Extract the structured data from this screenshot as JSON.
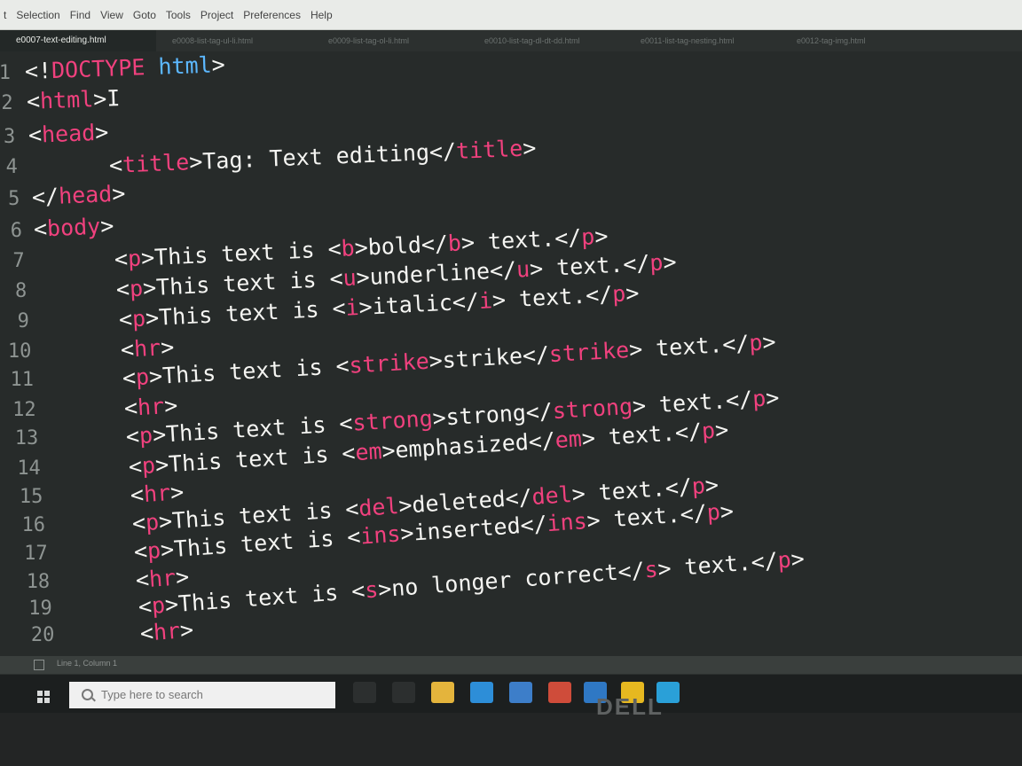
{
  "menu": [
    "t",
    "Selection",
    "Find",
    "View",
    "Goto",
    "Tools",
    "Project",
    "Preferences",
    "Help"
  ],
  "tabs": [
    {
      "label": "e0007-text-editing.html",
      "active": true
    },
    {
      "label": "e0008-list-tag-ul-li.html",
      "active": false
    },
    {
      "label": "e0009-list-tag-ol-li.html",
      "active": false
    },
    {
      "label": "e0010-list-tag-dl-dt-dd.html",
      "active": false
    },
    {
      "label": "e0011-list-tag-nesting.html",
      "active": false
    },
    {
      "label": "e0012-tag-img.html",
      "active": false
    }
  ],
  "lines": [
    {
      "num": "1",
      "indent": 0,
      "tokens": [
        {
          "t": "p",
          "v": "<!"
        },
        {
          "t": "t",
          "v": "DOCTYPE"
        },
        {
          "t": "p",
          "v": " "
        },
        {
          "t": "a",
          "v": "html"
        },
        {
          "t": "p",
          "v": ">"
        }
      ]
    },
    {
      "num": "2",
      "indent": 0,
      "tokens": [
        {
          "t": "p",
          "v": "<"
        },
        {
          "t": "t",
          "v": "html"
        },
        {
          "t": "p",
          "v": ">"
        },
        {
          "t": "p",
          "v": "I"
        }
      ]
    },
    {
      "num": "3",
      "indent": 0,
      "tokens": [
        {
          "t": "p",
          "v": "<"
        },
        {
          "t": "t",
          "v": "head"
        },
        {
          "t": "p",
          "v": ">"
        }
      ]
    },
    {
      "num": "4",
      "indent": 1,
      "tokens": [
        {
          "t": "p",
          "v": "<"
        },
        {
          "t": "t",
          "v": "title"
        },
        {
          "t": "p",
          "v": ">Tag: Text editing</"
        },
        {
          "t": "t",
          "v": "title"
        },
        {
          "t": "p",
          "v": ">"
        }
      ]
    },
    {
      "num": "5",
      "indent": 0,
      "tokens": [
        {
          "t": "p",
          "v": "</"
        },
        {
          "t": "t",
          "v": "head"
        },
        {
          "t": "p",
          "v": ">"
        }
      ]
    },
    {
      "num": "6",
      "indent": 0,
      "tokens": [
        {
          "t": "p",
          "v": "<"
        },
        {
          "t": "t",
          "v": "body"
        },
        {
          "t": "p",
          "v": ">"
        }
      ]
    },
    {
      "num": "7",
      "indent": 1,
      "tokens": [
        {
          "t": "p",
          "v": "<"
        },
        {
          "t": "t",
          "v": "p"
        },
        {
          "t": "p",
          "v": ">This text is <"
        },
        {
          "t": "t",
          "v": "b"
        },
        {
          "t": "p",
          "v": ">bold</"
        },
        {
          "t": "t",
          "v": "b"
        },
        {
          "t": "p",
          "v": "> text.</"
        },
        {
          "t": "t",
          "v": "p"
        },
        {
          "t": "p",
          "v": ">"
        }
      ]
    },
    {
      "num": "8",
      "indent": 1,
      "tokens": [
        {
          "t": "p",
          "v": "<"
        },
        {
          "t": "t",
          "v": "p"
        },
        {
          "t": "p",
          "v": ">This text is <"
        },
        {
          "t": "t",
          "v": "u"
        },
        {
          "t": "p",
          "v": ">underline</"
        },
        {
          "t": "t",
          "v": "u"
        },
        {
          "t": "p",
          "v": "> text.</"
        },
        {
          "t": "t",
          "v": "p"
        },
        {
          "t": "p",
          "v": ">"
        }
      ]
    },
    {
      "num": "9",
      "indent": 1,
      "tokens": [
        {
          "t": "p",
          "v": "<"
        },
        {
          "t": "t",
          "v": "p"
        },
        {
          "t": "p",
          "v": ">This text is <"
        },
        {
          "t": "t",
          "v": "i"
        },
        {
          "t": "p",
          "v": ">italic</"
        },
        {
          "t": "t",
          "v": "i"
        },
        {
          "t": "p",
          "v": "> text.</"
        },
        {
          "t": "t",
          "v": "p"
        },
        {
          "t": "p",
          "v": ">"
        }
      ]
    },
    {
      "num": "10",
      "indent": 1,
      "tokens": [
        {
          "t": "p",
          "v": "<"
        },
        {
          "t": "t",
          "v": "hr"
        },
        {
          "t": "p",
          "v": ">"
        }
      ]
    },
    {
      "num": "11",
      "indent": 1,
      "tokens": [
        {
          "t": "p",
          "v": "<"
        },
        {
          "t": "t",
          "v": "p"
        },
        {
          "t": "p",
          "v": ">This text is <"
        },
        {
          "t": "t",
          "v": "strike"
        },
        {
          "t": "p",
          "v": ">strike</"
        },
        {
          "t": "t",
          "v": "strike"
        },
        {
          "t": "p",
          "v": "> text.</"
        },
        {
          "t": "t",
          "v": "p"
        },
        {
          "t": "p",
          "v": ">"
        }
      ]
    },
    {
      "num": "12",
      "indent": 1,
      "tokens": [
        {
          "t": "p",
          "v": "<"
        },
        {
          "t": "t",
          "v": "hr"
        },
        {
          "t": "p",
          "v": ">"
        }
      ]
    },
    {
      "num": "13",
      "indent": 1,
      "tokens": [
        {
          "t": "p",
          "v": "<"
        },
        {
          "t": "t",
          "v": "p"
        },
        {
          "t": "p",
          "v": ">This text is <"
        },
        {
          "t": "t",
          "v": "strong"
        },
        {
          "t": "p",
          "v": ">strong</"
        },
        {
          "t": "t",
          "v": "strong"
        },
        {
          "t": "p",
          "v": "> text.</"
        },
        {
          "t": "t",
          "v": "p"
        },
        {
          "t": "p",
          "v": ">"
        }
      ]
    },
    {
      "num": "14",
      "indent": 1,
      "tokens": [
        {
          "t": "p",
          "v": "<"
        },
        {
          "t": "t",
          "v": "p"
        },
        {
          "t": "p",
          "v": ">This text is <"
        },
        {
          "t": "t",
          "v": "em"
        },
        {
          "t": "p",
          "v": ">emphasized</"
        },
        {
          "t": "t",
          "v": "em"
        },
        {
          "t": "p",
          "v": "> text.</"
        },
        {
          "t": "t",
          "v": "p"
        },
        {
          "t": "p",
          "v": ">"
        }
      ]
    },
    {
      "num": "15",
      "indent": 1,
      "tokens": [
        {
          "t": "p",
          "v": "<"
        },
        {
          "t": "t",
          "v": "hr"
        },
        {
          "t": "p",
          "v": ">"
        }
      ]
    },
    {
      "num": "16",
      "indent": 1,
      "tokens": [
        {
          "t": "p",
          "v": "<"
        },
        {
          "t": "t",
          "v": "p"
        },
        {
          "t": "p",
          "v": ">This text is <"
        },
        {
          "t": "t",
          "v": "del"
        },
        {
          "t": "p",
          "v": ">deleted</"
        },
        {
          "t": "t",
          "v": "del"
        },
        {
          "t": "p",
          "v": "> text.</"
        },
        {
          "t": "t",
          "v": "p"
        },
        {
          "t": "p",
          "v": ">"
        }
      ]
    },
    {
      "num": "17",
      "indent": 1,
      "tokens": [
        {
          "t": "p",
          "v": "<"
        },
        {
          "t": "t",
          "v": "p"
        },
        {
          "t": "p",
          "v": ">This text is <"
        },
        {
          "t": "t",
          "v": "ins"
        },
        {
          "t": "p",
          "v": ">inserted</"
        },
        {
          "t": "t",
          "v": "ins"
        },
        {
          "t": "p",
          "v": "> text.</"
        },
        {
          "t": "t",
          "v": "p"
        },
        {
          "t": "p",
          "v": ">"
        }
      ]
    },
    {
      "num": "18",
      "indent": 1,
      "tokens": [
        {
          "t": "p",
          "v": "<"
        },
        {
          "t": "t",
          "v": "hr"
        },
        {
          "t": "p",
          "v": ">"
        }
      ]
    },
    {
      "num": "19",
      "indent": 1,
      "tokens": [
        {
          "t": "p",
          "v": "<"
        },
        {
          "t": "t",
          "v": "p"
        },
        {
          "t": "p",
          "v": ">This text is <"
        },
        {
          "t": "t",
          "v": "s"
        },
        {
          "t": "p",
          "v": ">no longer correct</"
        },
        {
          "t": "t",
          "v": "s"
        },
        {
          "t": "p",
          "v": "> text.</"
        },
        {
          "t": "t",
          "v": "p"
        },
        {
          "t": "p",
          "v": ">"
        }
      ]
    },
    {
      "num": "20",
      "indent": 1,
      "tokens": [
        {
          "t": "p",
          "v": "<"
        },
        {
          "t": "t",
          "v": "hr"
        },
        {
          "t": "p",
          "v": ">"
        }
      ]
    }
  ],
  "status": {
    "position": "Line 1, Column 1"
  },
  "taskbar": {
    "search_placeholder": "Type here to search",
    "icons": [
      {
        "name": "cortana-icon",
        "color": "#2c2f2f"
      },
      {
        "name": "task-view-icon",
        "color": "#2c2f2f"
      },
      {
        "name": "file-explorer-icon",
        "color": "#e4b43c"
      },
      {
        "name": "edge-icon",
        "color": "#2d8ed8"
      },
      {
        "name": "store-icon",
        "color": "#3d7ec9"
      },
      {
        "name": "chrome-icon",
        "color": "#cf4c3a"
      },
      {
        "name": "mail-icon",
        "color": "#2f78c4"
      },
      {
        "name": "sticky-notes-icon",
        "color": "#e6b820"
      },
      {
        "name": "app-icon",
        "color": "#2aa0d8"
      }
    ]
  },
  "brand": "DELL",
  "colors": {
    "tag": "#f0417e",
    "attribute": "#5cb8ff",
    "text": "#f5f5f2",
    "line_number": "#8e9492",
    "background": "#272b2a"
  }
}
